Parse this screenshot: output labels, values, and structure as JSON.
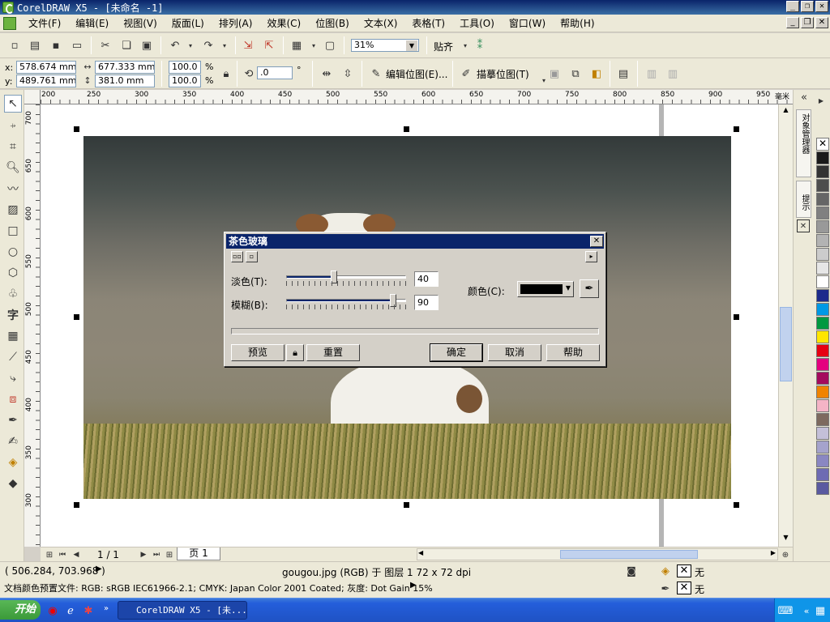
{
  "window": {
    "title": "CorelDRAW X5 - [未命名 -1]",
    "min_label": "_",
    "restore_label": "❐",
    "close_label": "✕"
  },
  "menu": {
    "items": [
      "文件(F)",
      "编辑(E)",
      "视图(V)",
      "版面(L)",
      "排列(A)",
      "效果(C)",
      "位图(B)",
      "文本(X)",
      "表格(T)",
      "工具(O)",
      "窗口(W)",
      "帮助(H)"
    ]
  },
  "toolbar": {
    "zoom_value": "31%",
    "snap_label": "贴齐",
    "edit_bitmap_label": "编辑位图(E)...",
    "trace_bitmap_label": "描摹位图(T)"
  },
  "propbar": {
    "x_label": "x:",
    "x_value": "578.674 mm",
    "y_label": "y:",
    "y_value": "489.761 mm",
    "w_value": "677.333 mm",
    "h_value": "381.0 mm",
    "scale_x": "100.0",
    "scale_y": "100.0",
    "percent": "%",
    "angle_value": ".0",
    "degree": "°"
  },
  "ruler": {
    "top_labels": [
      "200",
      "250",
      "300",
      "350",
      "400",
      "450",
      "500",
      "550",
      "600",
      "650",
      "700",
      "750",
      "800",
      "850",
      "900",
      "950"
    ],
    "unit": "毫米",
    "left_labels": [
      "700",
      "650",
      "600",
      "550",
      "500",
      "450",
      "400",
      "350",
      "300"
    ]
  },
  "dialog": {
    "title": "茶色玻璃",
    "fade_label": "淡色(T):",
    "fade_value": "40",
    "fade_percent": 0.4,
    "blur_label": "模糊(B):",
    "blur_value": "90",
    "blur_percent": 0.9,
    "color_label": "颜色(C):",
    "color_value": "#000000",
    "preview_label": "预览",
    "reset_label": "重置",
    "ok_label": "确定",
    "cancel_label": "取消",
    "help_label": "帮助"
  },
  "pager": {
    "page_count": "1 / 1",
    "page_tab": "页 1"
  },
  "status": {
    "coords": "( 506.284, 703.968 )",
    "object_info": "gougou.jpg (RGB) 于 图层 1 72 x 72 dpi",
    "color_profile": "文档颜色预置文件: RGB: sRGB IEC61966-2.1; CMYK: Japan Color 2001 Coated; 灰度: Dot Gain 15%",
    "fill_none": "无",
    "outline_none": "无"
  },
  "docker": {
    "tab1": "对象管理器",
    "tab2": "提示"
  },
  "taskbar": {
    "start_label": "开始",
    "task_label": "CorelDRAW X5 - [未..."
  },
  "palette": [
    "#ffffff",
    "#1a1a1a",
    "#333333",
    "#4d4d4d",
    "#666666",
    "#808080",
    "#999999",
    "#b3b3b3",
    "#cccccc",
    "#e6e6e6",
    "#ffffff",
    "#1c2a8c",
    "#0099e5",
    "#009940",
    "#ffe600",
    "#e60012",
    "#e4007f",
    "#a40b5d",
    "#f08300",
    "#f4b4c6",
    "#7d6a5f",
    "#c4c0d8",
    "#a5a3cc",
    "#8a87c2",
    "#6e6bb3",
    "#5a5aa0"
  ]
}
